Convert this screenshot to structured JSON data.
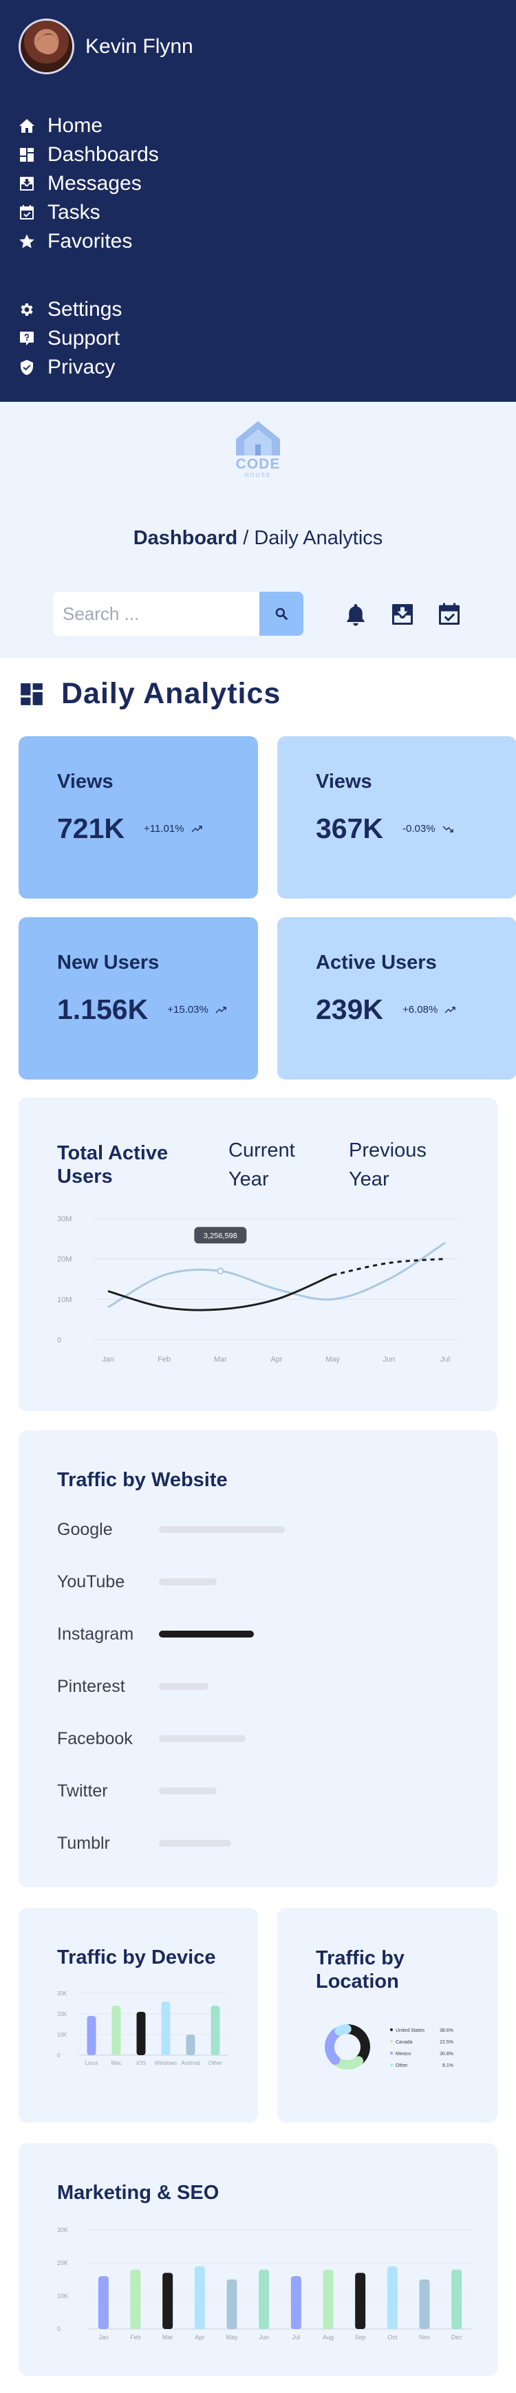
{
  "user": {
    "name": "Kevin Flynn"
  },
  "nav": {
    "primary": [
      {
        "label": "Home",
        "icon": "home-icon"
      },
      {
        "label": "Dashboards",
        "icon": "dashboard-icon"
      },
      {
        "label": "Messages",
        "icon": "inbox-icon"
      },
      {
        "label": "Tasks",
        "icon": "task-icon"
      },
      {
        "label": "Favorites",
        "icon": "star-icon"
      }
    ],
    "secondary": [
      {
        "label": "Settings",
        "icon": "gear-icon"
      },
      {
        "label": "Support",
        "icon": "help-icon"
      },
      {
        "label": "Privacy",
        "icon": "shield-icon"
      }
    ]
  },
  "logo": {
    "name": "CODE",
    "tagline": "HOUSE"
  },
  "breadcrumb": {
    "root": "Dashboard",
    "separator": " / ",
    "current": "Daily Analytics"
  },
  "search": {
    "placeholder": "Search ..."
  },
  "page_title": "Daily Analytics",
  "colors": {
    "navy": "#1b2a5c",
    "blue_dark": "#90bff9",
    "blue_light": "#badafd",
    "panel": "#eef4fd"
  },
  "stats": [
    {
      "label": "Views",
      "value": "721K",
      "change": "+11.01%",
      "trend": "up"
    },
    {
      "label": "Views",
      "value": "367K",
      "change": "-0.03%",
      "trend": "down"
    },
    {
      "label": "New Users",
      "value": "1.156K",
      "change": "+15.03%",
      "trend": "up"
    },
    {
      "label": "Active Users",
      "value": "239K",
      "change": "+6.08%",
      "trend": "up"
    }
  ],
  "active_users": {
    "title": "Total Active Users",
    "legend_current": "Current Year",
    "legend_previous": "Previous Year",
    "tooltip": "3,256,598"
  },
  "traffic_website": {
    "title": "Traffic by Website",
    "sites": [
      {
        "name": "Google",
        "share": 0.61,
        "highlight": false
      },
      {
        "name": "YouTube",
        "share": 0.28,
        "highlight": false
      },
      {
        "name": "Instagram",
        "share": 0.46,
        "highlight": true
      },
      {
        "name": "Pinterest",
        "share": 0.24,
        "highlight": false
      },
      {
        "name": "Facebook",
        "share": 0.42,
        "highlight": false
      },
      {
        "name": "Twitter",
        "share": 0.28,
        "highlight": false
      },
      {
        "name": "Tumblr",
        "share": 0.35,
        "highlight": false
      }
    ]
  },
  "traffic_device": {
    "title": "Traffic by Device"
  },
  "traffic_location": {
    "title": "Traffic by Location"
  },
  "marketing": {
    "title": "Marketing & SEO"
  },
  "chart_data": [
    {
      "type": "line",
      "title": "Total Active Users",
      "x": [
        "Jan",
        "Feb",
        "Mar",
        "Apr",
        "May",
        "Jun",
        "Jul"
      ],
      "y_ticks": [
        "30M",
        "20M",
        "10M",
        "0"
      ],
      "ylim": [
        0,
        30
      ],
      "series": [
        {
          "name": "Current Year",
          "values": [
            12,
            8,
            7.5,
            10,
            16,
            19,
            20
          ],
          "color": "#1c1c1c",
          "dashed_from_index": 4
        },
        {
          "name": "Previous Year",
          "values": [
            8,
            16,
            17,
            12.5,
            10,
            15,
            24
          ],
          "color": "#a9c9e3"
        }
      ],
      "annotation": {
        "label": "3,256,598",
        "x": "Mar"
      },
      "grid": true
    },
    {
      "type": "bar",
      "title": "Traffic by Device",
      "categories": [
        "Linux",
        "Mac",
        "iOS",
        "Windows",
        "Android",
        "Other"
      ],
      "y_ticks": [
        "30K",
        "20K",
        "10K",
        "0"
      ],
      "ylim": [
        0,
        30
      ],
      "values": [
        19,
        24,
        21,
        26,
        10,
        24
      ],
      "colors": [
        "#95a4fc",
        "#baedbd",
        "#1c1c1c",
        "#b1e3ff",
        "#a8c5da",
        "#a1e3cb"
      ]
    },
    {
      "type": "pie",
      "title": "Traffic by Location",
      "donut": true,
      "slices": [
        {
          "label": "United States",
          "value": 38.6,
          "display": "38.6%",
          "color": "#1c1c1c"
        },
        {
          "label": "Canada",
          "value": 22.5,
          "display": "22.5%",
          "color": "#baedbd"
        },
        {
          "label": "Mexico",
          "value": 30.8,
          "display": "30.8%",
          "color": "#95a4fc"
        },
        {
          "label": "Other",
          "value": 8.1,
          "display": "8.1%",
          "color": "#b1e3ff"
        }
      ]
    },
    {
      "type": "bar",
      "title": "Marketing & SEO",
      "categories": [
        "Jan",
        "Feb",
        "Mar",
        "Apr",
        "May",
        "Jun",
        "Jul",
        "Aug",
        "Sep",
        "Oct",
        "Nov",
        "Dec"
      ],
      "y_ticks": [
        "30K",
        "20K",
        "10K",
        "0"
      ],
      "ylim": [
        0,
        30
      ],
      "values": [
        16,
        18,
        17,
        19,
        15,
        18,
        16,
        18,
        17,
        19,
        15,
        18
      ],
      "colors": [
        "#95a4fc",
        "#baedbd",
        "#1c1c1c",
        "#b1e3ff",
        "#a8c5da",
        "#a1e3cb",
        "#95a4fc",
        "#baedbd",
        "#1c1c1c",
        "#b1e3ff",
        "#a8c5da",
        "#a1e3cb"
      ]
    }
  ]
}
